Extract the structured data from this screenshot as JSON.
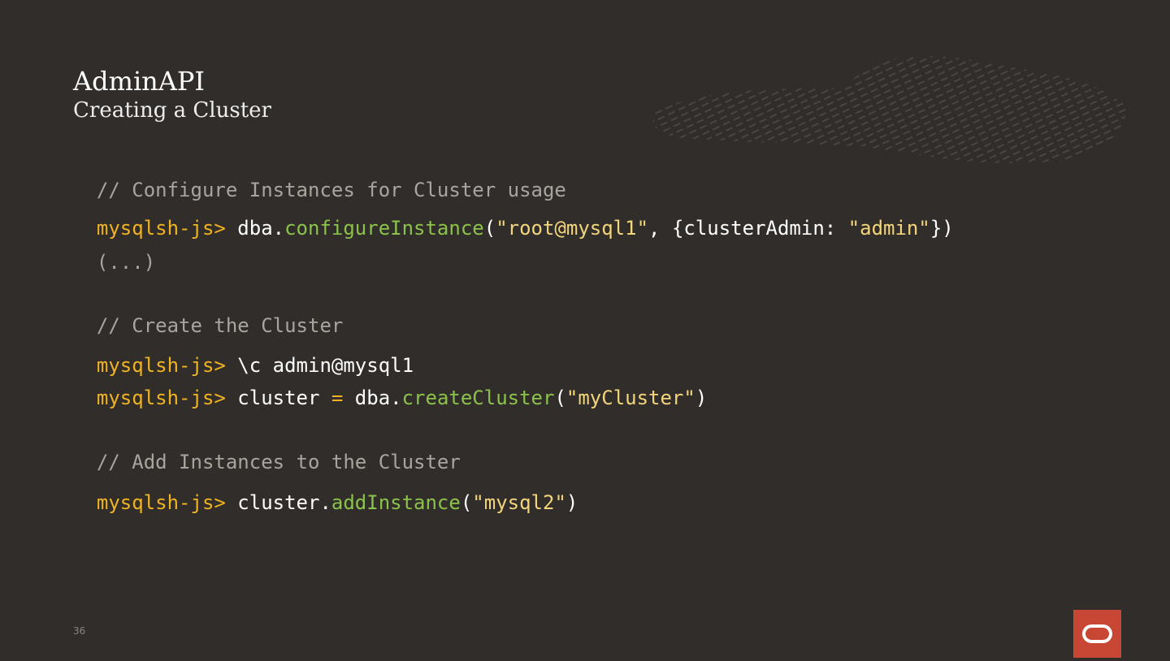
{
  "slide": {
    "title": "AdminAPI",
    "subtitle": "Creating a Cluster",
    "page_number": "36"
  },
  "code": {
    "comment1": "// Configure Instances for Cluster usage",
    "l1_prompt": "mysqlsh-js> ",
    "l1_obj": "dba.",
    "l1_fn": "configureInstance",
    "l1_open": "(",
    "l1_str": "\"root@mysql1\"",
    "l1_comma": ", ",
    "l1_obj_open": "{clusterAdmin: ",
    "l1_str2": "\"admin\"",
    "l1_close": "})",
    "ellipsis": "(...)",
    "comment2": "// Create the Cluster",
    "l2_prompt": "mysqlsh-js> ",
    "l2_cmd": "\\c admin@mysql1",
    "l3_prompt": "mysqlsh-js> ",
    "l3_var": "cluster ",
    "l3_eq": "=",
    "l3_obj": " dba.",
    "l3_fn": "createCluster",
    "l3_open": "(",
    "l3_str": "\"myCluster\"",
    "l3_close": ")",
    "comment3": "// Add Instances to the Cluster",
    "l4_prompt": "mysqlsh-js> ",
    "l4_obj": "cluster.",
    "l4_fn": "addInstance",
    "l4_open": "(",
    "l4_str": "\"mysql2\"",
    "l4_close": ")"
  },
  "colors": {
    "background": "#312d2a",
    "prompt": "#f0b322",
    "function": "#8bc34a",
    "string": "#f3d57b",
    "comment": "#a9a49f",
    "logo": "#c74634"
  },
  "icons": {
    "decoration": "texture-pattern-icon",
    "logo": "oracle-logo-icon"
  }
}
